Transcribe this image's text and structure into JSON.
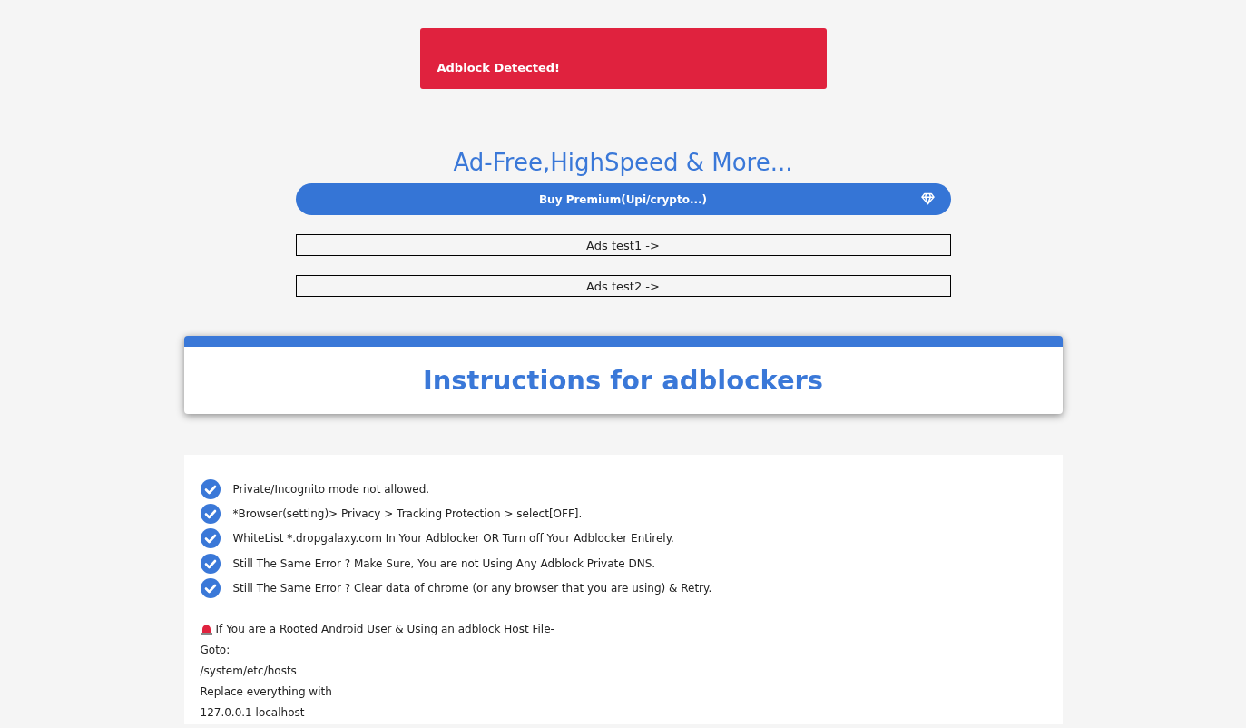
{
  "alert": {
    "text": "Adblock Detected!"
  },
  "promo": {
    "heading": "Ad-Free,HighSpeed & More...",
    "button": "Buy Premium(Upi/crypto...)"
  },
  "test_links": [
    "Ads test1 ->",
    "Ads test2 ->"
  ],
  "instructions_card": {
    "title": "Instructions for adblockers"
  },
  "checklist": [
    "Private/Incognito mode not allowed.",
    "*Browser(setting)> Privacy > Tracking Protection > select[OFF].",
    "WhiteList *.dropgalaxy.com In Your Adblocker OR Turn off Your Adblocker Entirely.",
    "Still The Same Error ? Make Sure, You are not Using Any Adblock Private DNS.",
    "Still The Same Error ? Clear data of chrome (or any browser that you are using) & Retry."
  ],
  "host_notes": {
    "warning": "If You are a Rooted Android User & Using an adblock Host File-",
    "lines": [
      "Goto:",
      "/system/etc/hosts",
      "Replace everything with",
      "127.0.0.1 localhost"
    ]
  }
}
